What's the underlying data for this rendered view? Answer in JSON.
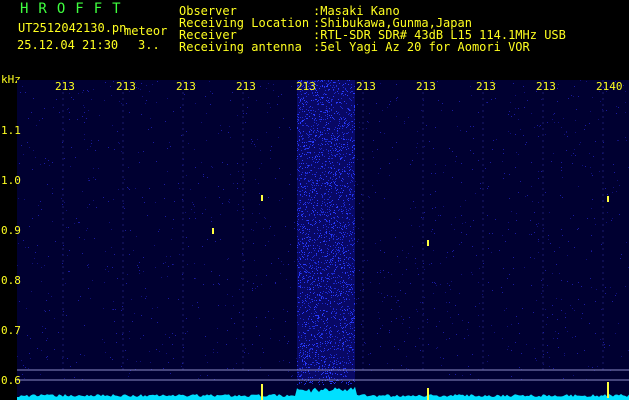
{
  "app_title": "HROFFT",
  "file_name": "UT2512042130.pn",
  "meteor_label": "meteor",
  "datetime": "25.12.04 21:30",
  "count": "3..",
  "info": [
    {
      "label": "Observer",
      "value": ":Masaki Kano"
    },
    {
      "label": "Receiving Location",
      "value": ":Shibukawa,Gunma,Japan"
    },
    {
      "label": "Receiver",
      "value": ":RTL-SDR SDR# 43dB L15 114.1MHz USB"
    },
    {
      "label": "Receiving antenna",
      "value": ":5el Yagi Az 20 for Aomori VOR"
    }
  ],
  "axis": {
    "unit": "kHz",
    "y_ticks": [
      "1.1",
      "1.0",
      "0.9",
      "0.8",
      "0.7",
      "0.6"
    ],
    "x_ticks": [
      "213",
      "213",
      "213",
      "213",
      "213",
      "213",
      "213",
      "213",
      "213",
      "2140"
    ]
  },
  "colors": {
    "background": "#000031",
    "text": "#ffff20",
    "title": "#3fff3f",
    "signal": "#2a3cff",
    "baseline": "#00e0ff",
    "ping": "#ffff40"
  }
}
